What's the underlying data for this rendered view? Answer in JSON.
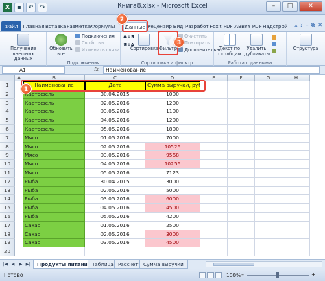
{
  "window": {
    "title": "Книга8.xlsx - Microsoft Excel"
  },
  "tabs": [
    "Файл",
    "Главная",
    "Вставка",
    "Разметка",
    "Формулы",
    "Данные",
    "Рецензир",
    "Вид",
    "Разработ",
    "Foxit PDF",
    "ABBYY PDF",
    "Надстрой"
  ],
  "active_tab": "Данные",
  "ribbon": {
    "get_external": "Получение внешних данных",
    "refresh_all": "Обновить все",
    "connections": "Подключения",
    "properties": "Свойства",
    "edit_links": "Изменить связи",
    "group_connections": "Подключения",
    "sort": "Сортировка",
    "filter": "Фильтр",
    "clear": "Очистить",
    "reapply": "Повторить",
    "advanced": "Дополнительно",
    "group_sort_filter": "Сортировка и фильтр",
    "text_to_columns": "Текст по столбцам",
    "remove_duplicates": "Удалить дубликаты",
    "group_data_tools": "Работа с данными",
    "outline": "Структура"
  },
  "formula_bar": {
    "namebox": "A1",
    "fx": "fx",
    "value": "Наименование"
  },
  "columns": [
    "A",
    "B",
    "C",
    "D",
    "E",
    "F",
    "G",
    "H"
  ],
  "table": {
    "headers": [
      "Наименование",
      "Дата",
      "Сумма выручки, руб."
    ],
    "rows": [
      [
        "Картофель",
        "30.04.2015",
        "1000"
      ],
      [
        "Картофель",
        "02.05.2016",
        "1200"
      ],
      [
        "Картофель",
        "03.05.2016",
        "1100"
      ],
      [
        "Картофель",
        "04.05.2016",
        "1200"
      ],
      [
        "Картофель",
        "05.05.2016",
        "1800"
      ],
      [
        "Мясо",
        "01.05.2016",
        "7000"
      ],
      [
        "Мясо",
        "02.05.2016",
        "10526"
      ],
      [
        "Мясо",
        "03.05.2016",
        "9568"
      ],
      [
        "Мясо",
        "04.05.2016",
        "10256"
      ],
      [
        "Мясо",
        "05.05.2016",
        "7123"
      ],
      [
        "Рыба",
        "30.04.2015",
        "3000"
      ],
      [
        "Рыба",
        "02.05.2016",
        "5000"
      ],
      [
        "Рыба",
        "03.05.2016",
        "6000"
      ],
      [
        "Рыба",
        "04.05.2016",
        "4500"
      ],
      [
        "Рыба",
        "05.05.2016",
        "4200"
      ],
      [
        "Сахар",
        "01.05.2016",
        "2500"
      ],
      [
        "Сахар",
        "02.05.2016",
        "3000"
      ],
      [
        "Сахар",
        "03.05.2016",
        "4500"
      ]
    ],
    "red_rows": [
      6,
      7,
      8,
      12,
      13,
      16,
      17
    ]
  },
  "row_numbers": [
    "1",
    "2",
    "3",
    "4",
    "5",
    "6",
    "7",
    "8",
    "9",
    "10",
    "11",
    "12",
    "13",
    "14",
    "15",
    "16",
    "17",
    "18",
    "19",
    "20"
  ],
  "badges": [
    "1",
    "2",
    "3"
  ],
  "sheet_tabs": [
    "Продукты питания",
    "Таблица",
    "Рассчет",
    "Сумма выручки"
  ],
  "status": {
    "ready": "Готово",
    "zoom": "100%"
  },
  "colors": {
    "green": "#7ccf43",
    "yellow": "#ffff00",
    "pink": "#fbc7ce",
    "red_text": "#9c0006",
    "accent": "#e8433a"
  }
}
